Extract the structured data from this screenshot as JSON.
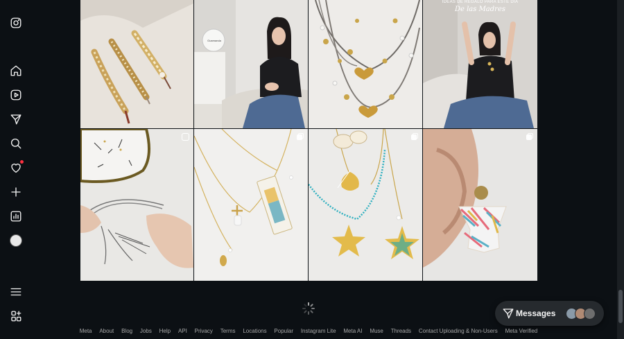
{
  "sidebar": {
    "items": [
      {
        "name": "instagram-logo-icon",
        "label": "Instagram"
      },
      {
        "name": "home-icon",
        "label": "Home"
      },
      {
        "name": "reels-icon",
        "label": "Reels"
      },
      {
        "name": "messages-icon",
        "label": "Messages"
      },
      {
        "name": "search-icon",
        "label": "Search"
      },
      {
        "name": "notifications-icon",
        "label": "Notifications"
      },
      {
        "name": "create-icon",
        "label": "Create"
      },
      {
        "name": "dashboard-icon",
        "label": "Dashboard"
      },
      {
        "name": "profile-avatar",
        "label": "Profile"
      },
      {
        "name": "menu-icon",
        "label": "More"
      },
      {
        "name": "also-from-meta-icon",
        "label": "Also from Meta"
      }
    ]
  },
  "grid": {
    "posts": [
      {
        "name": "post-bracelets",
        "type": "image"
      },
      {
        "name": "post-woman-seated",
        "type": "image",
        "brand_text": "Guamanda"
      },
      {
        "name": "post-heart-necklaces",
        "type": "image"
      },
      {
        "name": "post-gift-ideas",
        "type": "image",
        "overlay_top": "IDEAS DE REGALO PARA ESTE DÍA",
        "overlay_script": "De las Madres"
      },
      {
        "name": "post-cord-tutorial",
        "type": "reel"
      },
      {
        "name": "post-beaded-pendants",
        "type": "carousel"
      },
      {
        "name": "post-shell-starfish",
        "type": "carousel"
      },
      {
        "name": "post-beaded-earring",
        "type": "carousel"
      }
    ]
  },
  "messages": {
    "label": "Messages",
    "avatar_colors": [
      "#8a9aa8",
      "#b08a74",
      "#6e6e6e"
    ]
  },
  "footer": {
    "links": [
      "Meta",
      "About",
      "Blog",
      "Jobs",
      "Help",
      "API",
      "Privacy",
      "Terms",
      "Locations",
      "Popular",
      "Instagram Lite",
      "Meta AI",
      "Muse",
      "Threads",
      "Contact Uploading & Non-Users",
      "Meta Verified"
    ]
  },
  "colors": {
    "background": "#0c1014",
    "text": "#f5f5f5",
    "muted": "#a8a8a8",
    "notification": "#ff3040"
  }
}
